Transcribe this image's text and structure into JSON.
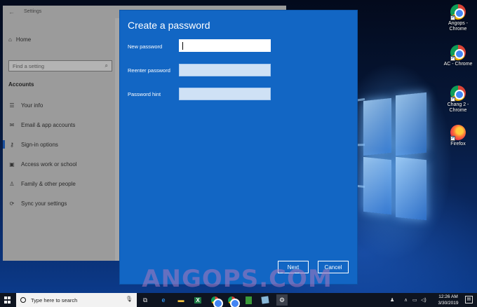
{
  "desktop": {
    "icons": [
      {
        "name": "Angops - Chrome",
        "label_line1": "Angops -",
        "label_line2": "Chrome",
        "icon": "chrome-icon"
      },
      {
        "name": "AC - Chrome",
        "label_line1": "AC - Chrome",
        "label_line2": "",
        "icon": "chrome-icon"
      },
      {
        "name": "Chang 2 - Chrome",
        "label_line1": "Chang 2 -",
        "label_line2": "Chrome",
        "icon": "chrome-icon"
      },
      {
        "name": "Firefox",
        "label_line1": "Firefox",
        "label_line2": "",
        "icon": "firefox-icon"
      }
    ]
  },
  "settings": {
    "title": "Settings",
    "home_label": "Home",
    "search_placeholder": "Find a setting",
    "section_heading": "Accounts",
    "nav_items": [
      {
        "label": "Your info",
        "icon": "person-card-icon",
        "active": false
      },
      {
        "label": "Email & app accounts",
        "icon": "mail-icon",
        "active": false
      },
      {
        "label": "Sign-in options",
        "icon": "key-icon",
        "active": true
      },
      {
        "label": "Access work or school",
        "icon": "briefcase-icon",
        "active": false
      },
      {
        "label": "Family & other people",
        "icon": "people-icon",
        "active": false
      },
      {
        "label": "Sync your settings",
        "icon": "sync-icon",
        "active": false
      }
    ]
  },
  "dialog": {
    "title": "Create a password",
    "new_password_label": "New password",
    "new_password_value": "",
    "reenter_password_label": "Reenter password",
    "reenter_password_value": "",
    "password_hint_label": "Password hint",
    "password_hint_value": "",
    "next_label": "Next",
    "cancel_label": "Cancel",
    "accent_color": "#1266c4"
  },
  "watermark": "ANGOPS.COM",
  "taskbar": {
    "search_placeholder": "Type here to search",
    "pinned": [
      "task-view-icon",
      "edge-icon",
      "file-explorer-icon",
      "excel-icon",
      "chrome-icon",
      "chrome-icon",
      "notepad-icon",
      "sticky-notes-icon",
      "settings-icon"
    ],
    "time": "12:26 AM",
    "date": "3/30/2019"
  }
}
